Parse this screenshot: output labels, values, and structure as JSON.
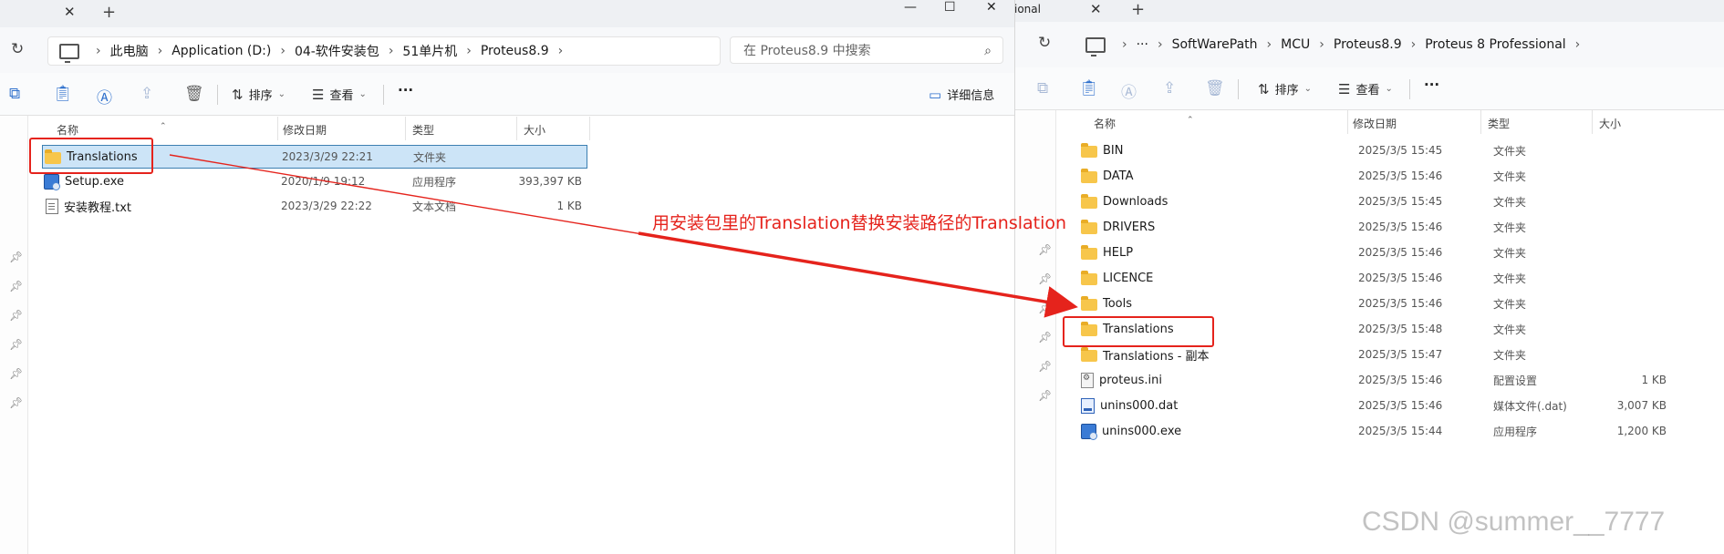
{
  "left": {
    "tab_close": "✕",
    "tab_new": "+",
    "window_controls": {
      "minimize": "—",
      "maximize": "☐",
      "close": "✕"
    },
    "breadcrumbs": [
      "此电脑",
      "Application (D:)",
      "04-软件安装包",
      "51单片机",
      "Proteus8.9"
    ],
    "search_placeholder": "在 Proteus8.9 中搜索",
    "toolbar": {
      "sort": "排序",
      "view": "查看",
      "more": "···",
      "details": "详细信息"
    },
    "columns": {
      "name": "名称",
      "date": "修改日期",
      "type": "类型",
      "size": "大小"
    },
    "files": [
      {
        "name": "Translations",
        "date": "2023/3/29 22:21",
        "type": "文件夹",
        "size": "",
        "icon": "folder-icon"
      },
      {
        "name": "Setup.exe",
        "date": "2020/1/9 19:12",
        "type": "应用程序",
        "size": "393,397 KB",
        "icon": "exe-icon"
      },
      {
        "name": "安装教程.txt",
        "date": "2023/3/29 22:22",
        "type": "文本文档",
        "size": "1 KB",
        "icon": "txt-icon"
      }
    ]
  },
  "right": {
    "tab_partial_title": "ional",
    "tab_close": "✕",
    "tab_new": "+",
    "breadcrumbs": [
      "···",
      "SoftWarePath",
      "MCU",
      "Proteus8.9",
      "Proteus 8 Professional"
    ],
    "toolbar": {
      "sort": "排序",
      "view": "查看",
      "more": "···"
    },
    "columns": {
      "name": "名称",
      "date": "修改日期",
      "type": "类型",
      "size": "大小"
    },
    "files": [
      {
        "name": "BIN",
        "date": "2025/3/5 15:45",
        "type": "文件夹",
        "size": "",
        "icon": "folder-icon"
      },
      {
        "name": "DATA",
        "date": "2025/3/5 15:46",
        "type": "文件夹",
        "size": "",
        "icon": "folder-icon"
      },
      {
        "name": "Downloads",
        "date": "2025/3/5 15:45",
        "type": "文件夹",
        "size": "",
        "icon": "folder-icon"
      },
      {
        "name": "DRIVERS",
        "date": "2025/3/5 15:46",
        "type": "文件夹",
        "size": "",
        "icon": "folder-icon"
      },
      {
        "name": "HELP",
        "date": "2025/3/5 15:46",
        "type": "文件夹",
        "size": "",
        "icon": "folder-icon"
      },
      {
        "name": "LICENCE",
        "date": "2025/3/5 15:46",
        "type": "文件夹",
        "size": "",
        "icon": "folder-icon"
      },
      {
        "name": "Tools",
        "date": "2025/3/5 15:46",
        "type": "文件夹",
        "size": "",
        "icon": "folder-icon"
      },
      {
        "name": "Translations",
        "date": "2025/3/5 15:48",
        "type": "文件夹",
        "size": "",
        "icon": "folder-icon"
      },
      {
        "name": "Translations - 副本",
        "date": "2025/3/5 15:47",
        "type": "文件夹",
        "size": "",
        "icon": "folder-icon"
      },
      {
        "name": "proteus.ini",
        "date": "2025/3/5 15:46",
        "type": "配置设置",
        "size": "1 KB",
        "icon": "ini-icon"
      },
      {
        "name": "unins000.dat",
        "date": "2025/3/5 15:46",
        "type": "媒体文件(.dat)",
        "size": "3,007 KB",
        "icon": "dat-icon"
      },
      {
        "name": "unins000.exe",
        "date": "2025/3/5 15:44",
        "type": "应用程序",
        "size": "1,200 KB",
        "icon": "exe-icon"
      }
    ]
  },
  "annotation": "用安装包里的Translation替换安装路径的Translation",
  "watermark": "CSDN @summer__7777",
  "colors": {
    "annotation_red": "#e5231c",
    "selection": "#cce4f7",
    "accent": "#2d6fcc"
  }
}
